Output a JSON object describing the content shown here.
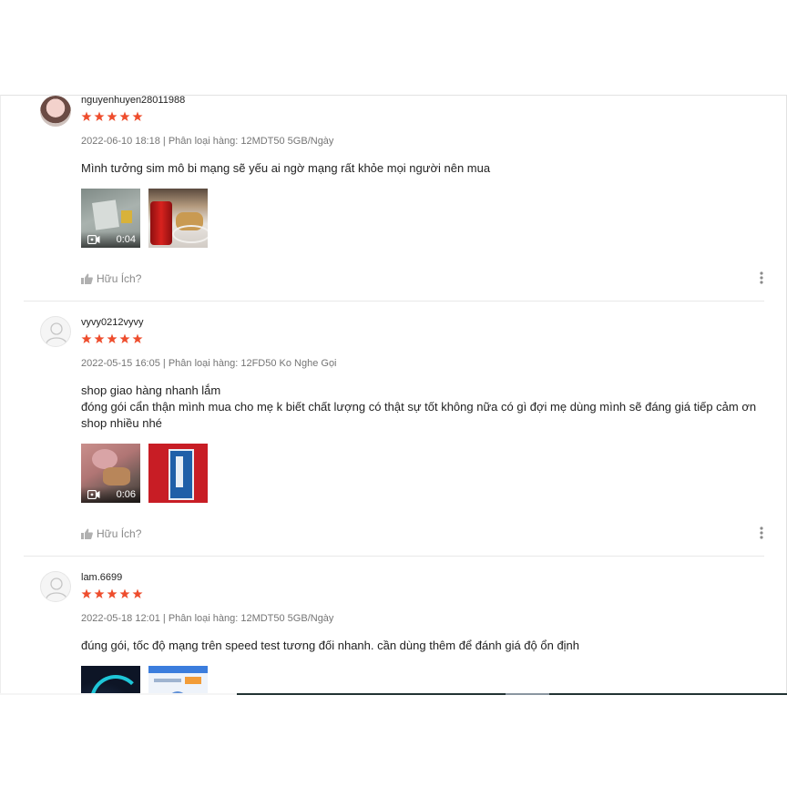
{
  "reviews": [
    {
      "username": "nguyenhuyen28011988",
      "avatar": "user-photo",
      "rating": 5,
      "meta": "2022-06-10 18:18 | Phân loại hàng: 12MDT50 5GB/Ngày",
      "comment": "Mình tưởng sim mô bi mạng sẽ yếu ai ngờ mạng rất khỏe mọi người nên mua",
      "video_duration": "0:04",
      "helpful": "Hữu Ích?"
    },
    {
      "username": "vyvy0212vyvy",
      "avatar": "default",
      "rating": 5,
      "meta": "2022-05-15 16:05 | Phân loại hàng: 12FD50 Ko Nghe Gọi",
      "comment": "shop giao hàng nhanh lắm\nđóng gói cẩn thận mình mua cho mẹ k biết chất lượng có thật sự tốt không nữa có gì đợi mẹ dùng mình sẽ đáng giá tiếp cảm ơn shop nhiều nhé",
      "video_duration": "0:06",
      "helpful": "Hữu Ích?"
    },
    {
      "username": "lam.6699",
      "avatar": "default",
      "rating": 5,
      "meta": "2022-05-18 12:01 | Phân loại hàng: 12MDT50 5GB/Ngày",
      "comment": "đúng gói, tốc độ mạng trên speed test tương đối nhanh. cần dùng thêm để đánh giá độ ổn định",
      "helpful": ""
    }
  ],
  "colors": {
    "star": "#ee4d2d",
    "meta": "#757575",
    "helpful": "#8a8a8a"
  },
  "icons": {
    "star": "star-icon",
    "like": "thumbs-up-icon",
    "more": "vertical-ellipsis-icon",
    "video": "video-camera-icon"
  }
}
